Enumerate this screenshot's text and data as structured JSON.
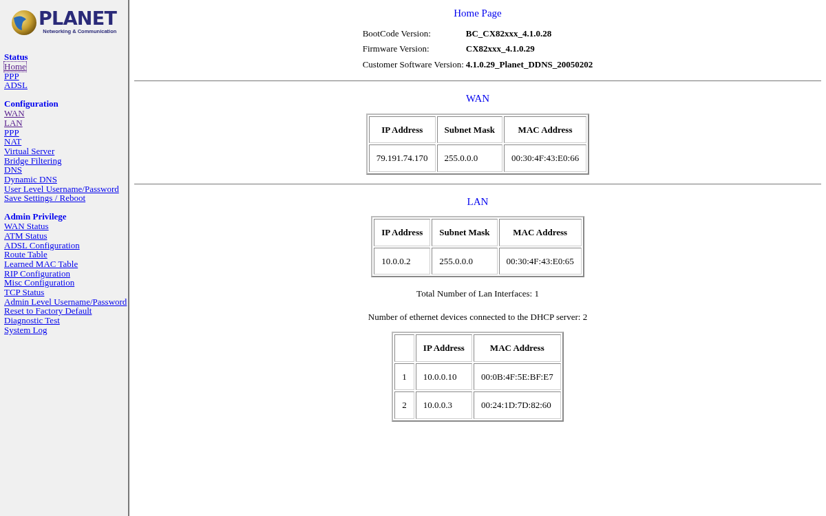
{
  "logo": {
    "name": "PLANET",
    "tagline": "Networking & Communication"
  },
  "sidebar": {
    "sections": [
      {
        "title": "Status",
        "items": [
          {
            "label": "Home",
            "visited": true,
            "focused": true
          },
          {
            "label": "PPP",
            "visited": false,
            "focused": false
          },
          {
            "label": "ADSL",
            "visited": false,
            "focused": false
          }
        ]
      },
      {
        "title": "Configuration",
        "items": [
          {
            "label": "WAN",
            "visited": true,
            "focused": false
          },
          {
            "label": "LAN",
            "visited": true,
            "focused": false
          },
          {
            "label": "PPP",
            "visited": false,
            "focused": false
          },
          {
            "label": "NAT",
            "visited": false,
            "focused": false
          },
          {
            "label": "Virtual Server",
            "visited": false,
            "focused": false
          },
          {
            "label": "Bridge Filtering",
            "visited": false,
            "focused": false
          },
          {
            "label": "DNS",
            "visited": false,
            "focused": false
          },
          {
            "label": "Dynamic DNS",
            "visited": false,
            "focused": false
          },
          {
            "label": "User Level Username/Password",
            "visited": false,
            "focused": false
          },
          {
            "label": "Save Settings / Reboot",
            "visited": false,
            "focused": false
          }
        ]
      },
      {
        "title": "Admin Privilege",
        "items": [
          {
            "label": "WAN Status",
            "visited": false,
            "focused": false
          },
          {
            "label": "ATM Status",
            "visited": false,
            "focused": false
          },
          {
            "label": "ADSL Configuration",
            "visited": false,
            "focused": false
          },
          {
            "label": "Route Table",
            "visited": false,
            "focused": false
          },
          {
            "label": "Learned MAC Table",
            "visited": false,
            "focused": false
          },
          {
            "label": "RIP Configuration",
            "visited": false,
            "focused": false
          },
          {
            "label": "Misc Configuration",
            "visited": false,
            "focused": false
          },
          {
            "label": "TCP Status",
            "visited": false,
            "focused": false
          },
          {
            "label": "Admin Level Username/Password",
            "visited": false,
            "focused": false
          },
          {
            "label": "Reset to Factory Default",
            "visited": false,
            "focused": false
          },
          {
            "label": "Diagnostic Test",
            "visited": false,
            "focused": false
          },
          {
            "label": "System Log",
            "visited": false,
            "focused": false
          }
        ]
      }
    ]
  },
  "page_title": "Home Page",
  "versions": [
    {
      "label": "BootCode Version:",
      "value": "BC_CX82xxx_4.1.0.28"
    },
    {
      "label": "Firmware Version:",
      "value": "CX82xxx_4.1.0.29"
    },
    {
      "label": "Customer Software Version:",
      "value": "4.1.0.29_Planet_DDNS_20050202"
    }
  ],
  "wan": {
    "title": "WAN",
    "table": {
      "columns": [
        "IP Address",
        "Subnet Mask",
        "MAC Address"
      ],
      "rows": [
        [
          "79.191.74.170",
          "255.0.0.0",
          "00:30:4F:43:E0:66"
        ]
      ]
    }
  },
  "lan": {
    "title": "LAN",
    "table": {
      "columns": [
        "IP Address",
        "Subnet Mask",
        "MAC Address"
      ],
      "rows": [
        [
          "10.0.0.2",
          "255.0.0.0",
          "00:30:4F:43:E0:65"
        ]
      ]
    },
    "interfaces_note": "Total Number of Lan Interfaces: 1",
    "dhcp_note": "Number of ethernet devices connected to the DHCP server: 2",
    "dhcp_table": {
      "columns": [
        "",
        "IP Address",
        "MAC Address"
      ],
      "rows": [
        [
          "1",
          "10.0.0.10",
          "00:0B:4F:5E:BF:E7"
        ],
        [
          "2",
          "10.0.0.3",
          "00:24:1D:7D:82:60"
        ]
      ]
    }
  }
}
